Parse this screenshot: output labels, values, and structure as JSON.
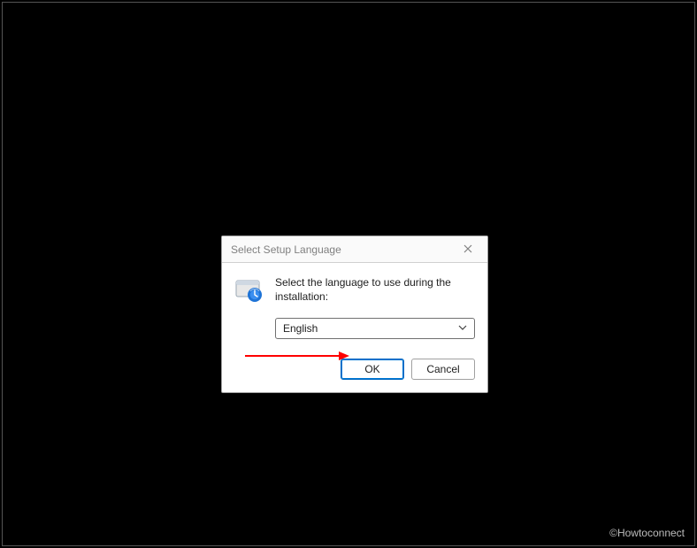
{
  "dialog": {
    "title": "Select Setup Language",
    "instruction": "Select the language to use during the installation:",
    "selected_language": "English",
    "ok_label": "OK",
    "cancel_label": "Cancel"
  },
  "watermark": "©Howtoconnect",
  "annotation": {
    "arrow_color": "#ff0000"
  }
}
